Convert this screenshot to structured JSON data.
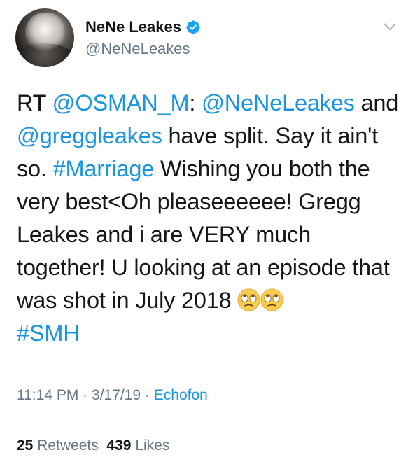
{
  "author": {
    "display_name": "NeNe Leakes",
    "handle": "@NeNeLeakes",
    "verified": true
  },
  "icons": {
    "avatar": "profile-photo",
    "verified": "verified-badge-icon",
    "menu": "chevron-down-icon",
    "emoji": "face-with-rolling-eyes"
  },
  "colors": {
    "link": "#1b95e0",
    "muted": "#657786",
    "text": "#14171a"
  },
  "tweet": {
    "rt": "RT",
    "mention_osman": "@OSMAN_M",
    "colon": ":",
    "mention_nene": "@NeNeLeakes",
    "and": "and",
    "mention_gregg": "@greggleakes",
    "text_split": "have split. Say it ain't so.",
    "hashtag_marriage": "#Marriage",
    "text_body": "Wishing you both the very best<Oh pleaseeeeee! Gregg Leakes and i are VERY much together! U looking at an episode that was shot in July 2018",
    "hashtag_smh": "#SMH"
  },
  "meta": {
    "time": "11:14 PM",
    "sep1": "·",
    "date": "3/17/19",
    "sep2": "·",
    "source": "Echofon"
  },
  "stats": {
    "retweets_count": "25",
    "retweets_label": "Retweets",
    "likes_count": "439",
    "likes_label": "Likes"
  }
}
